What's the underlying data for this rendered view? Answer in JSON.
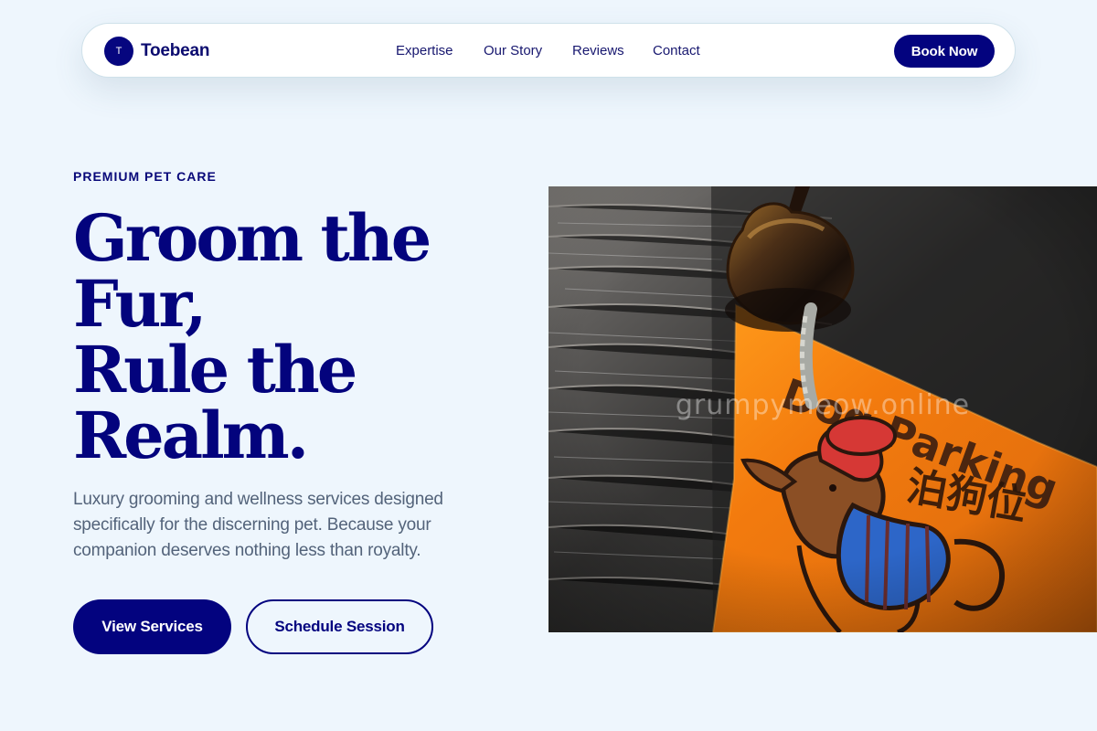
{
  "brand": {
    "mark": "T",
    "name": "Toebean"
  },
  "nav": {
    "links": [
      "Expertise",
      "Our Story",
      "Reviews",
      "Contact"
    ],
    "cta": "Book Now"
  },
  "hero": {
    "eyebrow": "PREMIUM PET CARE",
    "headline_lines": [
      "Groom the",
      "Fur,",
      "Rule the",
      "Realm."
    ],
    "subtitle": "Luxury grooming and wellness services designed specifically for the discerning pet. Because your companion deserves nothing less than royalty.",
    "primary_cta": "View Services",
    "secondary_cta": "Schedule Session"
  },
  "photo": {
    "watermark": "grumpymeow.online",
    "sign_text": "Dog Parking",
    "sign_text_cn": "泊狗位"
  },
  "colors": {
    "page_background": "#eef6fd",
    "navy": "#03037f",
    "body_text": "#53637a",
    "sign_orange": "#f47f10",
    "wood": "#5a5856"
  },
  "icons": {
    "brand_mark": "circle-initial",
    "photo_bell": "bell-icon"
  }
}
